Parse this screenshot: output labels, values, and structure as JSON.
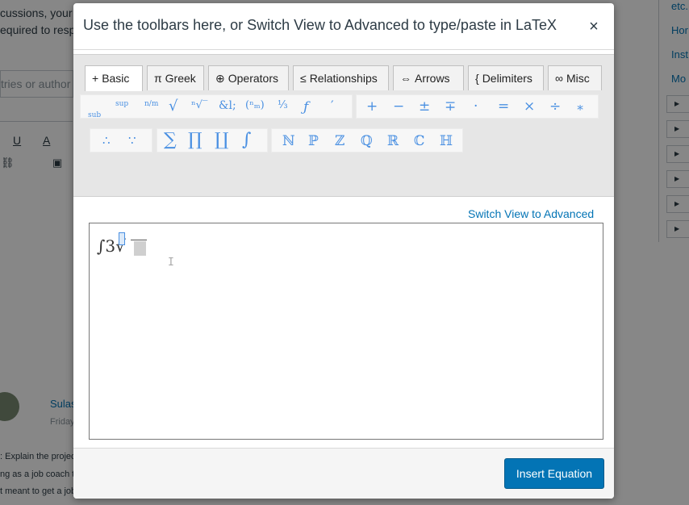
{
  "modal": {
    "title": "Use the toolbars here, or Switch View to Advanced to type/paste in LaTeX",
    "close_label": "×",
    "switch_view_label": "Switch View to Advanced",
    "insert_label": "Insert Equation"
  },
  "tabs": [
    {
      "icon": "+",
      "label": "Basic",
      "active": true
    },
    {
      "icon": "π",
      "label": "Greek"
    },
    {
      "icon": "⊕",
      "label": "Operators"
    },
    {
      "icon": "≤",
      "label": "Relationships"
    },
    {
      "icon": "⇔",
      "label": "Arrows"
    },
    {
      "icon": "{",
      "label": "Delimiters"
    },
    {
      "icon": "∞",
      "label": "Misc"
    }
  ],
  "toolbar": {
    "row1_group1": [
      "sup",
      "sub",
      "n/m",
      "√",
      "ⁿ√‾",
      "&l;",
      "(ⁿₘ)",
      "⅓",
      "ƒ",
      "′"
    ],
    "row1_group2": [
      "+",
      "−",
      "±",
      "∓",
      "·",
      "=",
      "×",
      "÷",
      "∗"
    ],
    "row2_group1": [
      "∴",
      "∵"
    ],
    "row2_group2": [
      "∑",
      "∏",
      "∐",
      "∫"
    ],
    "row2_group3": [
      "ℕ",
      "ℙ",
      "ℤ",
      "ℚ",
      "ℝ",
      "ℂ",
      "ℍ"
    ]
  },
  "editor": {
    "content_before": "∫3",
    "content_root": "√"
  },
  "background": {
    "left_texts": [
      "cussions, your",
      "equired to resp",
      "tries or author",
      "Sulas",
      "Friday",
      ": Explain the projec",
      "ng as a job coach to",
      "t meant to get a job"
    ],
    "right_texts": [
      "etc.",
      "Hor",
      "Inst",
      "Mo"
    ],
    "toolbar_letters": [
      "U",
      "A"
    ]
  },
  "colors": {
    "accent": "#0374b5",
    "math_symbol_blue": "#4a90e2"
  }
}
